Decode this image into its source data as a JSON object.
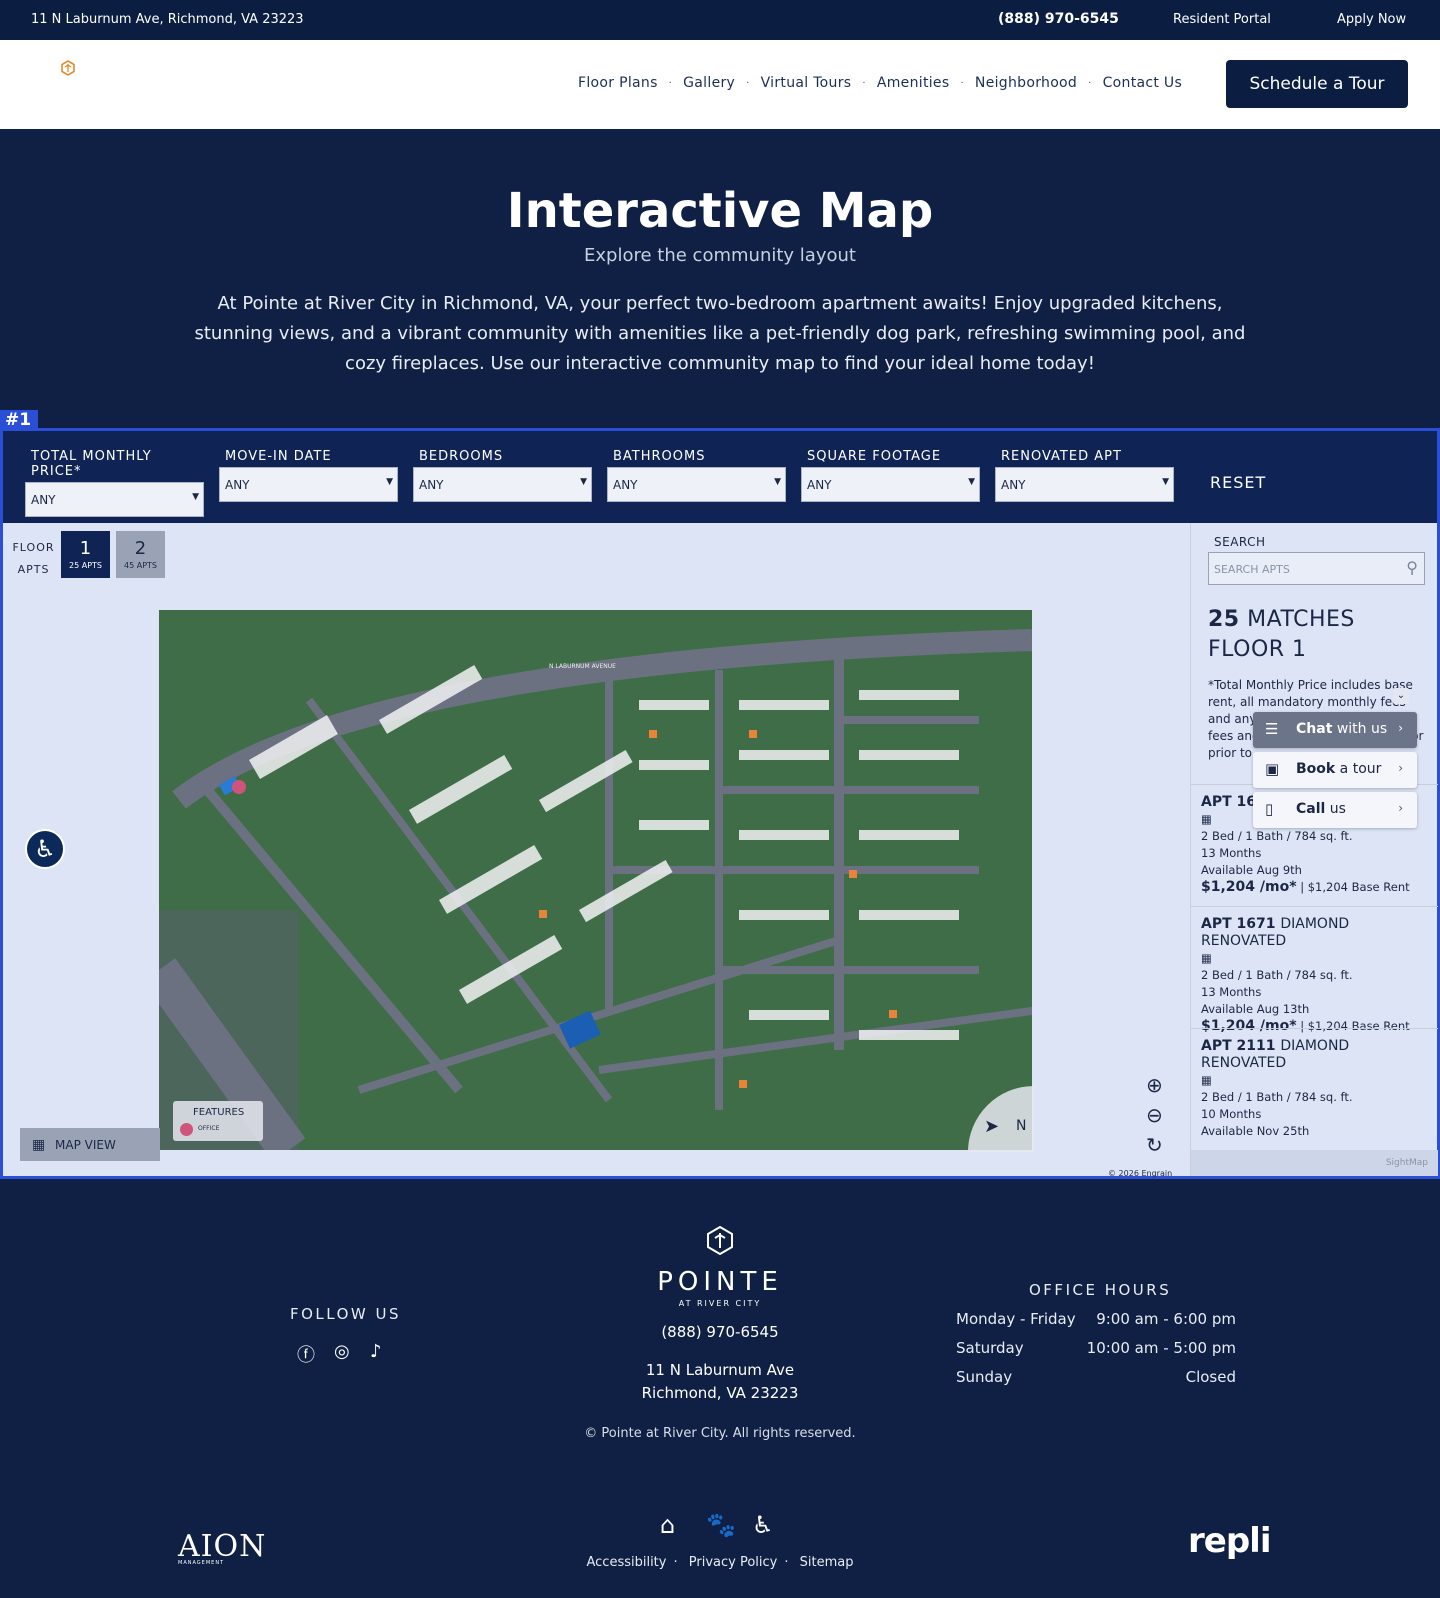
{
  "topbar": {
    "address": "11 N Laburnum Ave, Richmond, VA 23223",
    "phone": "(888) 970-6545",
    "resident_portal": "Resident Portal",
    "apply_now": "Apply Now"
  },
  "nav": {
    "links": [
      "Floor Plans",
      "Gallery",
      "Virtual Tours",
      "Amenities",
      "Neighborhood",
      "Contact Us"
    ],
    "cta": "Schedule a Tour"
  },
  "hero": {
    "title": "Interactive Map",
    "subtitle": "Explore the community layout",
    "description": "At Pointe at River City in Richmond, VA, your perfect two-bedroom apartment awaits! Enjoy upgraded kitchens, stunning views, and a vibrant community with amenities like a pet-friendly dog park, refreshing swimming pool, and cozy fireplaces. Use our interactive community map to find your ideal home today!"
  },
  "module_tag": "#1",
  "filters": [
    {
      "label": "TOTAL MONTHLY PRICE*",
      "value": "ANY"
    },
    {
      "label": "MOVE-IN DATE",
      "value": "ANY"
    },
    {
      "label": "BEDROOMS",
      "value": "ANY"
    },
    {
      "label": "BATHROOMS",
      "value": "ANY"
    },
    {
      "label": "SQUARE FOOTAGE",
      "value": "ANY"
    },
    {
      "label": "RENOVATED APT",
      "value": "ANY"
    }
  ],
  "reset": "RESET",
  "floor_picker": {
    "label_1": "FLOOR",
    "label_2": "APTS",
    "floors": [
      {
        "num": "1",
        "apts": "25 APTS",
        "active": true
      },
      {
        "num": "2",
        "apts": "45 APTS",
        "active": false
      }
    ]
  },
  "map": {
    "street_label": "N LABURNUM AVENUE",
    "view_button": "MAP VIEW",
    "features_title": "FEATURES",
    "features_item": "OFFICE",
    "compass": "N",
    "copyright": "© 2026 Engrain",
    "colors": {
      "grass": "#3d6b46",
      "road": "#6b7180",
      "building": "#f4f4f6",
      "highlight": "#e8843a",
      "pool": "#1a5fb4"
    }
  },
  "sidebar": {
    "search_label": "SEARCH",
    "search_placeholder": "SEARCH APTS",
    "matches_count": "25",
    "matches_word": "MATCHES",
    "floor_label": "FLOOR 1",
    "note": "*Total Monthly Price includes base rent, all mandatory monthly fees and any applicable... Excludes... fees and required charges due at or prior to...",
    "listings": [
      {
        "apt": "APT 16",
        "tag": "",
        "details": "2 Bed / 1 Bath / 784 sq. ft.",
        "term": "13 Months",
        "avail": "Available Aug 9th",
        "price": "$1,204 /mo*",
        "base": "$1,204 Base Rent"
      },
      {
        "apt": "APT 1671",
        "tag": "DIAMOND RENOVATED",
        "details": "2 Bed / 1 Bath / 784 sq. ft.",
        "term": "13 Months",
        "avail": "Available Aug 13th",
        "price": "$1,204 /mo*",
        "base": "$1,204 Base Rent"
      },
      {
        "apt": "APT 2111",
        "tag": "DIAMOND RENOVATED",
        "details": "2 Bed / 1 Bath / 784 sq. ft.",
        "term": "10 Months",
        "avail": "Available Nov 25th",
        "price": "",
        "base": ""
      }
    ],
    "sightmap": "SightMap"
  },
  "widget": {
    "chat_bold": "Chat",
    "chat_rest": " with us",
    "book_bold": "Book",
    "book_rest": " a tour",
    "call_bold": "Call",
    "call_rest": " us"
  },
  "footer": {
    "follow": "FOLLOW US",
    "brand": "POINTE",
    "brand_sub": "AT RIVER CITY",
    "phone": "(888) 970-6545",
    "address_1": "11 N Laburnum Ave",
    "address_2": "Richmond, VA 23223",
    "copyright": "© Pointe at River City. All rights reserved.",
    "hours_title": "OFFICE HOURS",
    "hours": [
      {
        "day": "Monday - Friday",
        "time": "9:00 am - 6:00 pm"
      },
      {
        "day": "Saturday",
        "time": "10:00 am - 5:00 pm"
      },
      {
        "day": "Sunday",
        "time": "Closed"
      }
    ],
    "aion": "AION",
    "aion_sub": "MANAGEMENT",
    "links": [
      "Accessibility",
      "Privacy Policy",
      "Sitemap"
    ],
    "repli": "repli"
  }
}
